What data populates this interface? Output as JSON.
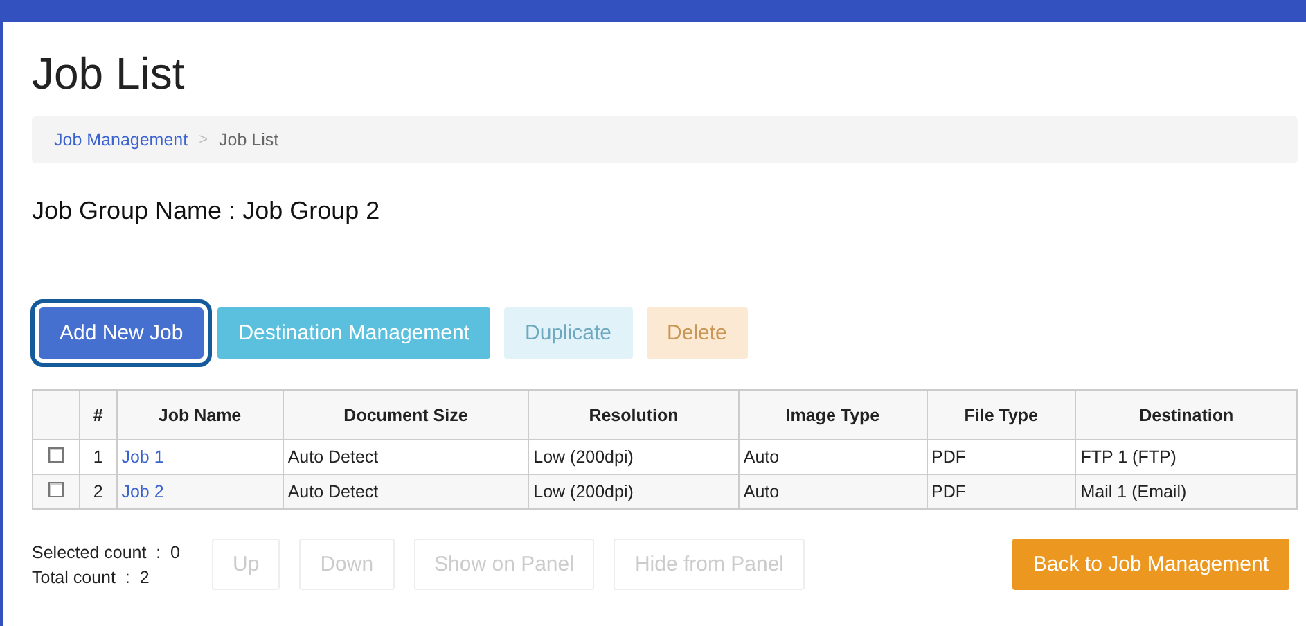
{
  "page": {
    "title": "Job List"
  },
  "breadcrumb": [
    {
      "label": "Job Management",
      "kind": "link"
    },
    {
      "label": "Job List",
      "kind": "current"
    }
  ],
  "breadcrumb_separator": ">",
  "group_name": "Job Group Name : Job Group 2",
  "actions": [
    {
      "label": "Add New Job",
      "kind": "primary",
      "disabled": false,
      "focused": true
    },
    {
      "label": "Destination Management",
      "kind": "info",
      "disabled": false,
      "focused": false
    },
    {
      "label": "Duplicate",
      "kind": "info",
      "disabled": true,
      "focused": false
    },
    {
      "label": "Delete",
      "kind": "warning",
      "disabled": true,
      "focused": false
    }
  ],
  "table": {
    "columns": [
      "#",
      "Job Name",
      "Document Size",
      "Resolution",
      "Image Type",
      "File Type",
      "Destination"
    ],
    "rows": [
      {
        "checked": false,
        "cells": [
          "1",
          "Job 1",
          "Auto Detect",
          "Low (200dpi)",
          "Auto",
          "PDF",
          "FTP 1 (FTP)"
        ]
      },
      {
        "checked": false,
        "cells": [
          "2",
          "Job 2",
          "Auto Detect",
          "Low (200dpi)",
          "Auto",
          "PDF",
          "Mail 1 (Email)"
        ]
      }
    ]
  },
  "counts": [
    "Selected count  :  0",
    "Total count  :  2"
  ],
  "row_actions": [
    {
      "label": "Up",
      "kind": "default",
      "disabled": true
    },
    {
      "label": "Down",
      "kind": "default",
      "disabled": true
    },
    {
      "label": "Show on Panel",
      "kind": "default",
      "disabled": true
    },
    {
      "label": "Hide from Panel",
      "kind": "default",
      "disabled": true
    }
  ],
  "back_button": {
    "label": "Back to Job Management",
    "kind": "warning",
    "disabled": false
  }
}
